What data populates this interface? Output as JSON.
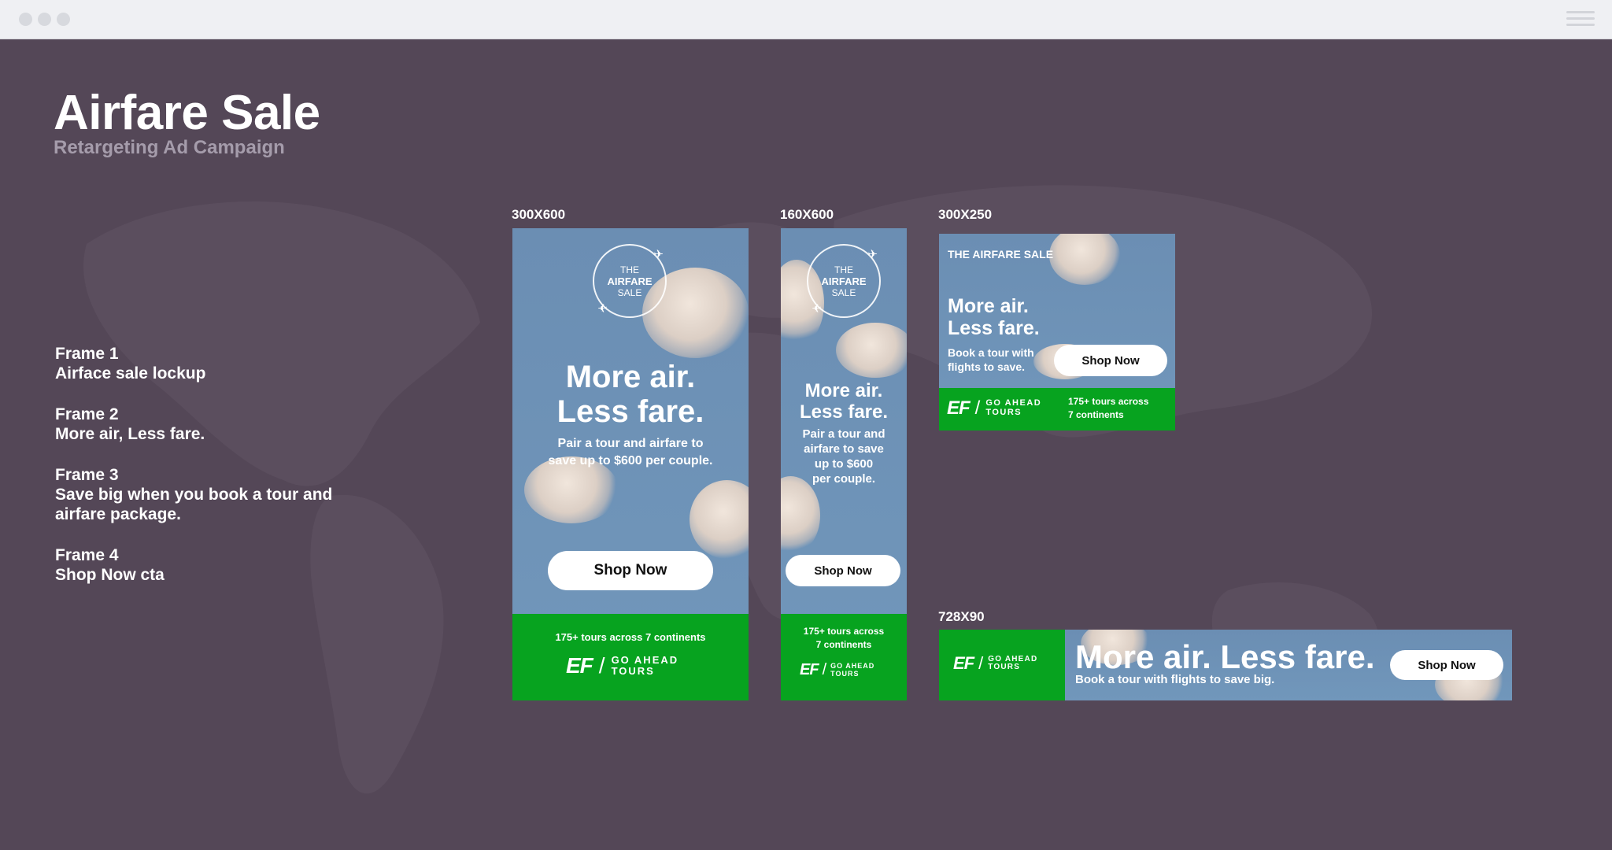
{
  "window": {
    "accent": "#544757"
  },
  "header": {
    "title": "Airfare Sale",
    "subtitle": "Retargeting Ad Campaign"
  },
  "frames": [
    {
      "title": "Frame 1",
      "desc": "Airface sale lockup"
    },
    {
      "title": "Frame 2",
      "desc": "More air, Less fare."
    },
    {
      "title": "Frame 3",
      "desc": "Save big when you book a tour and airfare package."
    },
    {
      "title": "Frame 4",
      "desc": "Shop Now cta"
    }
  ],
  "ads": {
    "ad300x600": {
      "label": "300X600",
      "lockup": {
        "l1": "THE",
        "l2": "AIRFARE",
        "l3": "SALE"
      },
      "headline1": "More air.",
      "headline2": "Less fare.",
      "sub1": "Pair a tour and airfare to",
      "sub2": "save up to $600 per couple.",
      "cta": "Shop Now",
      "tours": "175+ tours across 7 continents",
      "logo_mark": "EF",
      "logo_line1": "GO AHEAD",
      "logo_line2": "TOURS"
    },
    "ad160x600": {
      "label": "160X600",
      "lockup": {
        "l1": "THE",
        "l2": "AIRFARE",
        "l3": "SALE"
      },
      "headline1": "More air.",
      "headline2": "Less fare.",
      "sub1": "Pair a tour and",
      "sub2": "airfare to save",
      "sub3": "up to $600",
      "sub4": "per couple.",
      "cta": "Shop Now",
      "tours1": "175+ tours across",
      "tours2": "7 continents",
      "logo_mark": "EF",
      "logo_line1": "GO AHEAD",
      "logo_line2": "TOURS"
    },
    "ad300x250": {
      "label": "300X250",
      "kicker": "THE AIRFARE SALE",
      "headline1": "More air.",
      "headline2": "Less fare.",
      "sub1": "Book a tour with",
      "sub2": "flights to save.",
      "cta": "Shop Now",
      "tours1": "175+ tours across",
      "tours2": "7 continents",
      "logo_mark": "EF",
      "logo_line1": "GO AHEAD",
      "logo_line2": "TOURS"
    },
    "ad728x90": {
      "label": "728X90",
      "headline": "More air. Less fare.",
      "sub": "Book a tour with flights to save big.",
      "cta": "Shop Now",
      "logo_mark": "EF",
      "logo_line1": "GO AHEAD",
      "logo_line2": "TOURS"
    }
  },
  "colors": {
    "background": "#544757",
    "sky": "#6d90b5",
    "green": "#07a31f",
    "cta_bg": "#ffffff"
  },
  "icons": {
    "plane": "airplane-icon",
    "menu": "hamburger-menu-icon"
  }
}
